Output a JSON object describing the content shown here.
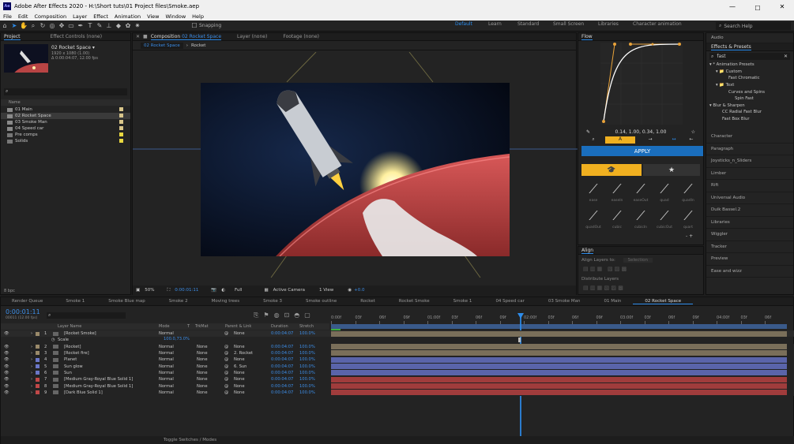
{
  "window": {
    "title": "Adobe After Effects 2020 - H:\\Short tuts\\01 Project files\\Smoke.aep",
    "minimize": "—",
    "maximize": "☐",
    "close": "✕",
    "app_badge": "Ae"
  },
  "menu": [
    "File",
    "Edit",
    "Composition",
    "Layer",
    "Effect",
    "Animation",
    "View",
    "Window",
    "Help"
  ],
  "toolbar": {
    "snapping": "Snapping",
    "workspaces": [
      "Default",
      "Learn",
      "Standard",
      "Small Screen",
      "Libraries",
      "Character animation"
    ],
    "search_help": "Search Help"
  },
  "project": {
    "tab_project": "Project",
    "tab_effect_controls": "Effect Controls (none)",
    "comp_name": "02 Rocket Space ▾",
    "comp_info": "1920 x 1080 (1.00)",
    "comp_duration": "Δ 0:00:04:07, 12.00 fps",
    "name_header": "Name",
    "items": [
      {
        "name": "01 Main",
        "color": "#d8c58a"
      },
      {
        "name": "02 Rocket Space",
        "color": "#d8c58a",
        "selected": true
      },
      {
        "name": "03 Smoke Man",
        "color": "#d8c58a"
      },
      {
        "name": "04 Speed car",
        "color": "#d8c58a"
      },
      {
        "name": "Pre comps",
        "color": "#e8d840"
      },
      {
        "name": "Solids",
        "color": "#e8d840"
      }
    ],
    "bpc": "8 bpc"
  },
  "comp_viewer": {
    "tab_comp_prefix": "Composition",
    "tab_comp_name": "02 Rocket Space",
    "tab_layer": "Layer (none)",
    "tab_footage": "Footage (none)",
    "nav_active": "02 Rocket Space",
    "nav_next": "Rocket",
    "zoom": "50%",
    "timecode": "0:00:01:11",
    "resolution": "Full",
    "camera": "Active Camera",
    "views": "1 View",
    "exposure": "+0.0"
  },
  "flow": {
    "title": "Flow",
    "values": "0.14, 1.00, 0.34, 1.00",
    "apply": "APPLY",
    "presets_row1": [
      "ease",
      "easeIn",
      "easeOut",
      "quad",
      "quadIn"
    ],
    "presets_row2": [
      "quadOut",
      "cubic",
      "cubicIn",
      "cubicOut",
      "quart"
    ]
  },
  "align": {
    "title": "Align",
    "align_to": "Align Layers to:",
    "align_to_value": "Selection",
    "distribute": "Distribute Layers"
  },
  "right": {
    "audio": "Audio",
    "effects_presets": "Effects & Presets",
    "search_value": "fast",
    "tree": [
      {
        "label": "▾ * Animation Presets",
        "indent": 0
      },
      {
        "label": "▾ 📁 Custom",
        "indent": 1
      },
      {
        "label": "Fast Chromatic",
        "indent": 3
      },
      {
        "label": "▾ 📁 Text",
        "indent": 1
      },
      {
        "label": "Curves and Spins",
        "indent": 3
      },
      {
        "label": "Spin Fast",
        "indent": 4
      },
      {
        "label": "▾ Blur & Sharpen",
        "indent": 0
      },
      {
        "label": "CC Radial Fast Blur",
        "indent": 2
      },
      {
        "label": "Fast Box Blur",
        "indent": 2
      }
    ],
    "panels": [
      "Character",
      "Paragraph",
      "Joysticks_n_Sliders",
      "Limber",
      "Rift",
      "Universal Audio",
      "Duik Bassel.2",
      "Libraries",
      "Wiggler",
      "Tracker",
      "Preview",
      "Ease and wizz"
    ]
  },
  "timeline": {
    "tabs": [
      "Render Queue",
      "Smoke 1",
      "Smoke Blue map",
      "Smoke 2",
      "Moving trees",
      "Smoke 3",
      "Smoke outline",
      "Rocket",
      "Rocket Smoke",
      "Smoke 1",
      "04 Speed car",
      "03 Smoke Man",
      "01 Main",
      "02 Rocket Space"
    ],
    "timecode": "0:00:01:11",
    "timecode_sub": "00011 (12.00 fps)",
    "headers": {
      "layer_name": "Layer Name",
      "mode": "Mode",
      "t": "T",
      "trkmat": "TrkMat",
      "parent": "Parent & Link",
      "duration": "Duration",
      "stretch": "Stretch"
    },
    "ruler": [
      "0:00f",
      "03f",
      "06f",
      "09f",
      "01:00f",
      "03f",
      "06f",
      "09f",
      "02:00f",
      "03f",
      "06f",
      "09f",
      "03:00f",
      "03f",
      "06f",
      "09f",
      "04:00f",
      "03f",
      "06f"
    ],
    "scale_label": "Scale",
    "scale_value": "100.0,73.0%",
    "layers": [
      {
        "num": "1",
        "name": "[Rocket Smoke]",
        "mode": "Normal",
        "trk": "",
        "parent": "None",
        "dur": "0:00:04:07",
        "str": "100.0%",
        "color": "#9a8a6a",
        "bar": "#7a6f5a"
      },
      {
        "num": "2",
        "name": "[Rocket]",
        "mode": "Normal",
        "trk": "None",
        "parent": "None",
        "dur": "0:00:04:07",
        "str": "100.0%",
        "color": "#9a8a6a",
        "bar": "#7a6f5a"
      },
      {
        "num": "3",
        "name": "[Rocket fire]",
        "mode": "Normal",
        "trk": "None",
        "parent": "2. Rocket",
        "dur": "0:00:04:07",
        "str": "100.0%",
        "color": "#9a8a6a",
        "bar": "#7a6f5a"
      },
      {
        "num": "4",
        "name": "Planet",
        "mode": "Normal",
        "trk": "None",
        "parent": "None",
        "dur": "0:00:04:07",
        "str": "100.0%",
        "color": "#6b77c8",
        "bar": "#5a64aa"
      },
      {
        "num": "5",
        "name": "Sun glow",
        "mode": "Normal",
        "trk": "None",
        "parent": "6. Sun",
        "dur": "0:00:04:07",
        "str": "100.0%",
        "color": "#6b77c8",
        "bar": "#5a64aa"
      },
      {
        "num": "6",
        "name": "Sun",
        "mode": "Normal",
        "trk": "None",
        "parent": "None",
        "dur": "0:00:04:07",
        "str": "100.0%",
        "color": "#6b77c8",
        "bar": "#5a64aa"
      },
      {
        "num": "7",
        "name": "[Medium Gray-Royal Blue Solid 1]",
        "mode": "Normal",
        "trk": "None",
        "parent": "None",
        "dur": "0:00:04:07",
        "str": "100.0%",
        "color": "#c04848",
        "bar": "#a03c3c"
      },
      {
        "num": "8",
        "name": "[Medium Gray-Royal Blue Solid 1]",
        "mode": "Normal",
        "trk": "None",
        "parent": "None",
        "dur": "0:00:04:07",
        "str": "100.0%",
        "color": "#c04848",
        "bar": "#a03c3c"
      },
      {
        "num": "9",
        "name": "[Dark Blue Solid 1]",
        "mode": "Normal",
        "trk": "None",
        "parent": "None",
        "dur": "0:00:04:07",
        "str": "100.0%",
        "color": "#c04848",
        "bar": "#a03c3c"
      }
    ],
    "toggle": "Toggle Switches / Modes"
  }
}
